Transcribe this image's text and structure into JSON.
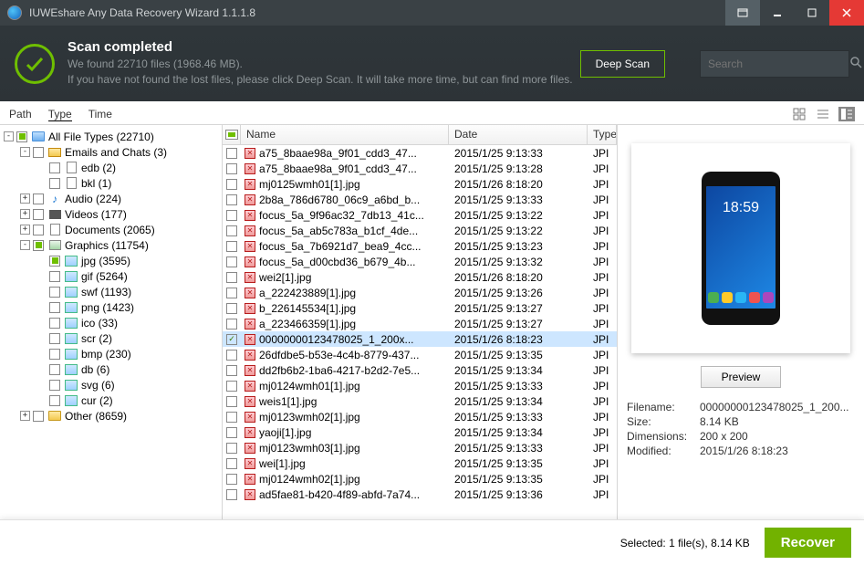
{
  "titlebar": {
    "title": "IUWEshare Any Data Recovery Wizard 1.1.1.8"
  },
  "header": {
    "title": "Scan completed",
    "line1": "We found 22710 files (1968.46 MB).",
    "line2": "If you have not found the lost files, please click Deep Scan. It will take more time, but can find more files.",
    "deep_scan": "Deep Scan",
    "search_placeholder": "Search"
  },
  "tabs": {
    "path": "Path",
    "type": "Type",
    "time": "Time"
  },
  "tree": [
    {
      "depth": 0,
      "exp": "-",
      "chk": "partial",
      "icon": "mon",
      "label": "All File Types (22710)"
    },
    {
      "depth": 1,
      "exp": "-",
      "chk": "",
      "icon": "mail",
      "label": "Emails and Chats (3)"
    },
    {
      "depth": 2,
      "exp": "",
      "chk": "",
      "icon": "file",
      "label": "edb (2)"
    },
    {
      "depth": 2,
      "exp": "",
      "chk": "",
      "icon": "file",
      "label": "bkl (1)"
    },
    {
      "depth": 1,
      "exp": "+",
      "chk": "",
      "icon": "aud",
      "label": "Audio (224)"
    },
    {
      "depth": 1,
      "exp": "+",
      "chk": "",
      "icon": "vid",
      "label": "Videos (177)"
    },
    {
      "depth": 1,
      "exp": "+",
      "chk": "",
      "icon": "doc",
      "label": "Documents (2065)"
    },
    {
      "depth": 1,
      "exp": "-",
      "chk": "partial",
      "icon": "gra",
      "label": "Graphics (11754)"
    },
    {
      "depth": 2,
      "exp": "",
      "chk": "partial",
      "icon": "thumb",
      "label": "jpg (3595)"
    },
    {
      "depth": 2,
      "exp": "",
      "chk": "",
      "icon": "thumb",
      "label": "gif (5264)"
    },
    {
      "depth": 2,
      "exp": "",
      "chk": "",
      "icon": "thumb",
      "label": "swf (1193)"
    },
    {
      "depth": 2,
      "exp": "",
      "chk": "",
      "icon": "thumb",
      "label": "png (1423)"
    },
    {
      "depth": 2,
      "exp": "",
      "chk": "",
      "icon": "thumb",
      "label": "ico (33)"
    },
    {
      "depth": 2,
      "exp": "",
      "chk": "",
      "icon": "thumb",
      "label": "scr (2)"
    },
    {
      "depth": 2,
      "exp": "",
      "chk": "",
      "icon": "thumb",
      "label": "bmp (230)"
    },
    {
      "depth": 2,
      "exp": "",
      "chk": "",
      "icon": "thumb",
      "label": "db (6)"
    },
    {
      "depth": 2,
      "exp": "",
      "chk": "",
      "icon": "thumb",
      "label": "svg (6)"
    },
    {
      "depth": 2,
      "exp": "",
      "chk": "",
      "icon": "thumb",
      "label": "cur (2)"
    },
    {
      "depth": 1,
      "exp": "+",
      "chk": "",
      "icon": "folder",
      "label": "Other (8659)"
    }
  ],
  "list": {
    "columns": {
      "name": "Name",
      "date": "Date",
      "type": "Type"
    },
    "rows": [
      {
        "chk": "",
        "name": "a75_8baae98a_9f01_cdd3_47...",
        "date": "2015/1/25 9:13:33",
        "type": "JPI",
        "sel": false
      },
      {
        "chk": "",
        "name": "a75_8baae98a_9f01_cdd3_47...",
        "date": "2015/1/25 9:13:28",
        "type": "JPI",
        "sel": false
      },
      {
        "chk": "",
        "name": "mj0125wmh01[1].jpg",
        "date": "2015/1/26 8:18:20",
        "type": "JPI",
        "sel": false
      },
      {
        "chk": "",
        "name": "2b8a_786d6780_06c9_a6bd_b...",
        "date": "2015/1/25 9:13:33",
        "type": "JPI",
        "sel": false
      },
      {
        "chk": "",
        "name": "focus_5a_9f96ac32_7db13_41c...",
        "date": "2015/1/25 9:13:22",
        "type": "JPI",
        "sel": false
      },
      {
        "chk": "",
        "name": "focus_5a_ab5c783a_b1cf_4de...",
        "date": "2015/1/25 9:13:22",
        "type": "JPI",
        "sel": false
      },
      {
        "chk": "",
        "name": "focus_5a_7b6921d7_bea9_4cc...",
        "date": "2015/1/25 9:13:23",
        "type": "JPI",
        "sel": false
      },
      {
        "chk": "",
        "name": "focus_5a_d00cbd36_b679_4b...",
        "date": "2015/1/25 9:13:32",
        "type": "JPI",
        "sel": false
      },
      {
        "chk": "",
        "name": "wei2[1].jpg",
        "date": "2015/1/26 8:18:20",
        "type": "JPI",
        "sel": false
      },
      {
        "chk": "",
        "name": "a_222423889[1].jpg",
        "date": "2015/1/25 9:13:26",
        "type": "JPI",
        "sel": false
      },
      {
        "chk": "",
        "name": "b_226145534[1].jpg",
        "date": "2015/1/25 9:13:27",
        "type": "JPI",
        "sel": false
      },
      {
        "chk": "",
        "name": "a_223466359[1].jpg",
        "date": "2015/1/25 9:13:27",
        "type": "JPI",
        "sel": false
      },
      {
        "chk": "✓",
        "name": "00000000123478025_1_200x...",
        "date": "2015/1/26 8:18:23",
        "type": "JPI",
        "sel": true
      },
      {
        "chk": "",
        "name": "26dfdbe5-b53e-4c4b-8779-437...",
        "date": "2015/1/25 9:13:35",
        "type": "JPI",
        "sel": false
      },
      {
        "chk": "",
        "name": "dd2fb6b2-1ba6-4217-b2d2-7e5...",
        "date": "2015/1/25 9:13:34",
        "type": "JPI",
        "sel": false
      },
      {
        "chk": "",
        "name": "mj0124wmh01[1].jpg",
        "date": "2015/1/25 9:13:33",
        "type": "JPI",
        "sel": false
      },
      {
        "chk": "",
        "name": "weis1[1].jpg",
        "date": "2015/1/25 9:13:34",
        "type": "JPI",
        "sel": false
      },
      {
        "chk": "",
        "name": "mj0123wmh02[1].jpg",
        "date": "2015/1/25 9:13:33",
        "type": "JPI",
        "sel": false
      },
      {
        "chk": "",
        "name": "yaoji[1].jpg",
        "date": "2015/1/25 9:13:34",
        "type": "JPI",
        "sel": false
      },
      {
        "chk": "",
        "name": "mj0123wmh03[1].jpg",
        "date": "2015/1/25 9:13:33",
        "type": "JPI",
        "sel": false
      },
      {
        "chk": "",
        "name": "wei[1].jpg",
        "date": "2015/1/25 9:13:35",
        "type": "JPI",
        "sel": false
      },
      {
        "chk": "",
        "name": "mj0124wmh02[1].jpg",
        "date": "2015/1/25 9:13:35",
        "type": "JPI",
        "sel": false
      },
      {
        "chk": "",
        "name": "ad5fae81-b420-4f89-abfd-7a74...",
        "date": "2015/1/25 9:13:36",
        "type": "JPI",
        "sel": false
      }
    ]
  },
  "preview": {
    "button": "Preview",
    "clock": "18:59",
    "labels": {
      "filename": "Filename:",
      "size": "Size:",
      "dimensions": "Dimensions:",
      "modified": "Modified:"
    },
    "values": {
      "filename": "00000000123478025_1_200...",
      "size": "8.14 KB",
      "dimensions": "200 x 200",
      "modified": "2015/1/26 8:18:23"
    }
  },
  "footer": {
    "status": "Selected: 1 file(s), 8.14 KB",
    "recover": "Recover"
  }
}
